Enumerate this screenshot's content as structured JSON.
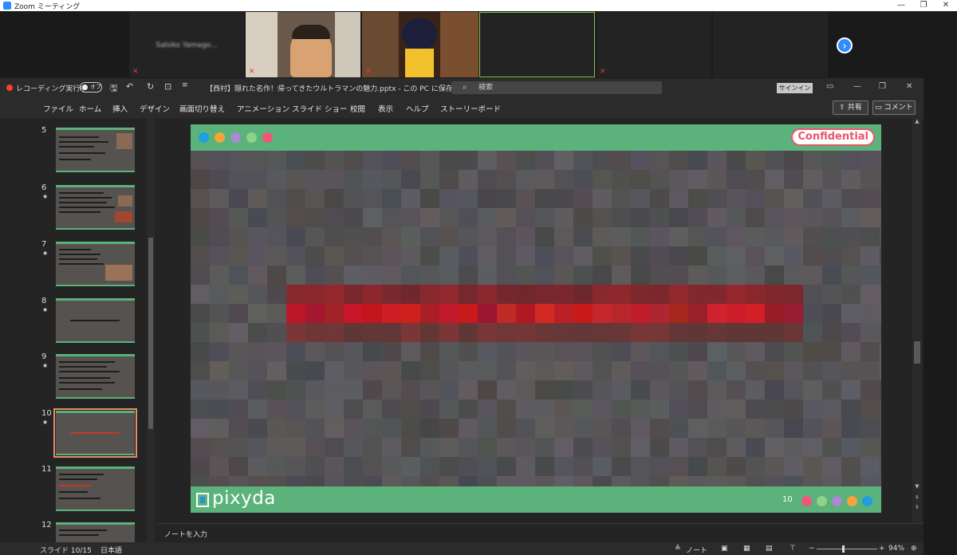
{
  "zoom_window": {
    "title": "Zoom ミーティング",
    "controls": [
      "—",
      "❐",
      "✕"
    ]
  },
  "participants": [
    {
      "name": "Satoko Yamago...",
      "muted": true
    },
    {
      "name": "",
      "muted": true,
      "video": "person"
    },
    {
      "name": "",
      "muted": true,
      "video": "avatar"
    },
    {
      "name": "",
      "muted": false,
      "active": true
    },
    {
      "name": "",
      "muted": true
    },
    {
      "name": "",
      "muted": false
    }
  ],
  "powerpoint": {
    "autosave_label": "レコーディング実行中",
    "autosave_state": "オフ",
    "doc_title": "【西村】隠れた名作！帰ってきたウルトラマンの魅力.pptx - この PC に保存済み ⌄",
    "search_placeholder": "検索",
    "signin": "サインイン",
    "ribbon_tabs": [
      "ファイル",
      "ホーム",
      "挿入",
      "デザイン",
      "画面切り替え",
      "アニメーション",
      "スライド ショー",
      "校閲",
      "表示",
      "ヘルプ",
      "ストーリーボード"
    ],
    "share": "共有",
    "comment": "コメント"
  },
  "thumbnails": [
    {
      "num": "5",
      "star": false
    },
    {
      "num": "6",
      "star": true
    },
    {
      "num": "7",
      "star": true
    },
    {
      "num": "8",
      "star": true
    },
    {
      "num": "9",
      "star": true
    },
    {
      "num": "10",
      "star": true,
      "selected": true
    },
    {
      "num": "11",
      "star": false
    },
    {
      "num": "12",
      "star": false
    }
  ],
  "slide": {
    "badge": "Confidential",
    "logo_text": "pixyda",
    "page_number": "10",
    "header_dots": [
      "#1e9fe0",
      "#f5a43a",
      "#a98ad3",
      "#8fd28a",
      "#f0567a"
    ],
    "footer_dots": [
      "#f0567a",
      "#8fd28a",
      "#a98ad3",
      "#f5a43a",
      "#1e9fe0"
    ]
  },
  "notes_placeholder": "ノートを入力",
  "status": {
    "slide_indicator": "スライド 10/15",
    "language": "日本語",
    "notes_button": "ノート",
    "zoom_level": "94%"
  }
}
